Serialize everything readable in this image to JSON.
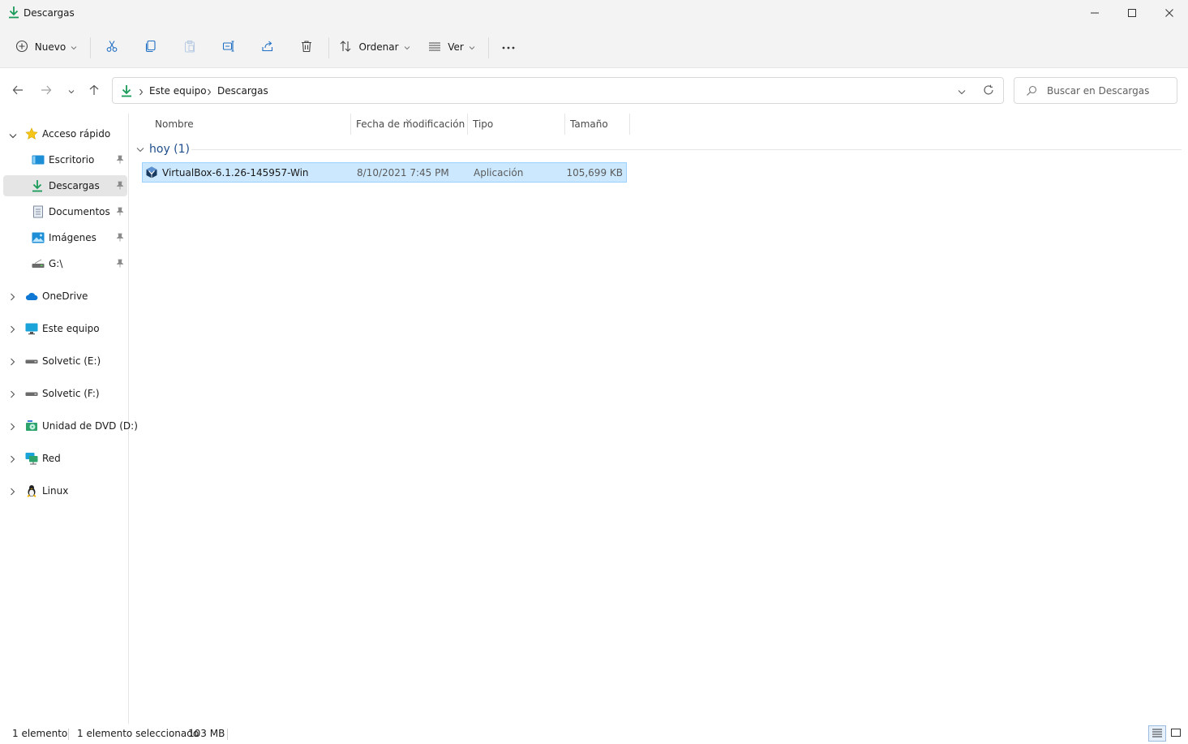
{
  "window": {
    "title": "Descargas",
    "minimize_label": "minimize",
    "maximize_label": "maximize",
    "close_label": "close"
  },
  "toolbar": {
    "new_label": "Nuevo",
    "sort_label": "Ordenar",
    "view_label": "Ver",
    "more_label": "···"
  },
  "address": {
    "crumbs": [
      "Este equipo",
      "Descargas"
    ]
  },
  "search": {
    "placeholder": "Buscar en Descargas"
  },
  "sidebar": {
    "quick_access": "Acceso rápido",
    "items": [
      {
        "label": "Escritorio",
        "icon": "desktop-icon",
        "pinned": true
      },
      {
        "label": "Descargas",
        "icon": "download-icon",
        "pinned": true,
        "active": true
      },
      {
        "label": "Documentos",
        "icon": "documents-icon",
        "pinned": true
      },
      {
        "label": "Imágenes",
        "icon": "pictures-icon",
        "pinned": true
      },
      {
        "label": "G:\\",
        "icon": "drive-icon",
        "pinned": true
      }
    ],
    "locations": [
      {
        "label": "OneDrive",
        "icon": "cloud-icon"
      },
      {
        "label": "Este equipo",
        "icon": "monitor-icon"
      },
      {
        "label": "Solvetic (E:)",
        "icon": "drive-icon"
      },
      {
        "label": "Solvetic (F:)",
        "icon": "drive-icon"
      },
      {
        "label": "Unidad de DVD (D:)",
        "icon": "dvd-icon"
      },
      {
        "label": "Red",
        "icon": "network-icon"
      },
      {
        "label": "Linux",
        "icon": "linux-icon"
      }
    ]
  },
  "columns": {
    "name": "Nombre",
    "date": "Fecha de modificación",
    "type": "Tipo",
    "size": "Tamaño"
  },
  "group": {
    "label": "hoy (1)"
  },
  "files": [
    {
      "name": "VirtualBox-6.1.26-145957-Win",
      "date": "8/10/2021 7:45 PM",
      "type": "Aplicación",
      "size": "105,699 KB",
      "selected": true
    }
  ],
  "status": {
    "count": "1 elemento",
    "selected": "1 elemento seleccionado",
    "size": "103 MB"
  },
  "colors": {
    "accent_green": "#1a9b5a",
    "selection_bg": "#cce8ff",
    "selection_border": "#99d1ff",
    "group_label": "#1f4e8c"
  }
}
